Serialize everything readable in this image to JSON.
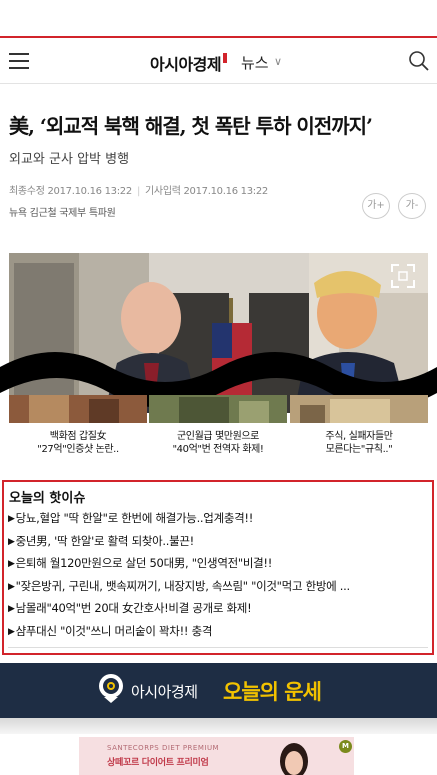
{
  "header": {
    "logo": "아시아경제",
    "section": "뉴스",
    "chevron": "∨"
  },
  "article": {
    "title": "美, ‘외교적 북핵 해결, 첫 폭탄 투하 이전까지’",
    "subtitle": "외교와 군사 압박 병행",
    "updated": "최종수정 2017.10.16 13:22",
    "published": "기사입력 2017.10.16 13:22",
    "reporter": "뉴욕 김근철 국제부 특파원",
    "font_up": "가+",
    "font_down": "가-"
  },
  "related": [
    {
      "line1": "백화점 갑질女",
      "line2": "\"27억\"인증샷 논란.."
    },
    {
      "line1": "군인월급 몇만원으로",
      "line2": "\"40억\"번 전역자 화제!"
    },
    {
      "line1": "주식, 실패자들만",
      "line2": "모른다는\"규칙..\""
    }
  ],
  "hot_issues": {
    "title": "오늘의 핫이슈",
    "items": [
      "당뇨,혈압 \"딱 한알\"로 한번에 해결가능..업계충격!!",
      "중년男, '딱 한알'로 활력 되찾아..불끈!",
      "은퇴해 월120만원으로 살던 50대男, \"인생역전\"비결!!",
      "\"잦은방귀, 구린내, 뱃속찌꺼기, 내장지방, 속쓰림\" \"이것\"먹고 한방에 ...",
      "남몰래\"40억\"번 20대 女간호사!비결 공개로 화제!",
      "샴푸대신 \"이것\"쓰니 머리숱이 꽉차!! 충격"
    ]
  },
  "banner": {
    "brand": "아시아경제",
    "luck": "오늘의 운세"
  },
  "ad": {
    "small": "SANTECORPS DIET PREMIUM",
    "main": "상떼꼬르 다이어트 프리미엄",
    "badge": "M"
  },
  "colors": {
    "accent": "#d2242b",
    "banner_bg": "#1e2d44",
    "banner_highlight": "#f2c200"
  }
}
